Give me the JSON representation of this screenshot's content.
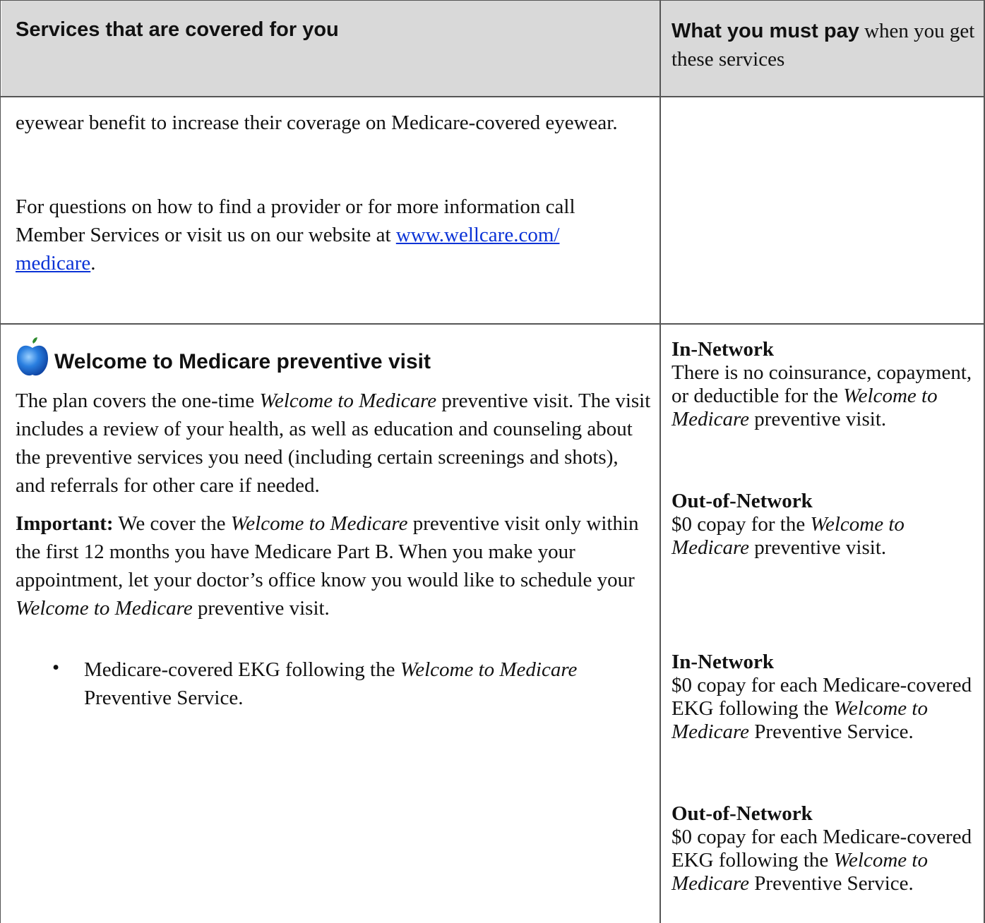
{
  "header": {
    "left": "Services that are covered for you",
    "right_bold": "What you must pay",
    "right_rest": " when you get these services"
  },
  "row1": {
    "p1": "eyewear benefit to increase their coverage on Medicare-covered eyewear.",
    "p2_before": "For questions on how to find a provider or for more information call Member Services or visit us on our website at ",
    "p2_link": "www.wellcare.com/ medicare",
    "p2_after": "."
  },
  "row2": {
    "icon": "apple-icon",
    "title": "Welcome to Medicare preventive visit",
    "p1_a": "The plan covers the one-time ",
    "p1_i": "Welcome to Medicare",
    "p1_b": " preventive visit. The visit includes a review of your health, as well as education and counseling about the preventive services you need (including certain screenings and shots), and referrals for other care if needed.",
    "p2_bold": "Important:",
    "p2_a": " We cover the ",
    "p2_i1": "Welcome to Medicare",
    "p2_b": " preventive visit only within the first 12 months you have Medicare Part B. When you make your appointment, let your doctor’s office know you would like to schedule your ",
    "p2_i2": "Welcome to Medicare",
    "p2_c": " preventive visit.",
    "bullet": "•",
    "bullet_a": "Medicare-covered EKG following the ",
    "bullet_i": "Welcome to Medicare",
    "bullet_b": " Preventive Service.",
    "right1": {
      "in_heading": "In-Network",
      "in_a": "There is no coinsurance, copayment, or deductible for the ",
      "in_i": "Welcome to Medicare",
      "in_b": " preventive visit.",
      "out_heading": "Out-of-Network",
      "out_a": "$0 copay for the ",
      "out_i": "Welcome to Medicare",
      "out_b": " preventive visit."
    },
    "right2": {
      "in_heading": "In-Network",
      "in_a": "$0 copay for each Medicare-covered EKG following the ",
      "in_i": "Welcome to Medicare",
      "in_b": " Preventive Service.",
      "out_heading": "Out-of-Network",
      "out_a": "$0 copay for each Medicare-covered EKG following the ",
      "out_i": "Welcome to Medicare",
      "out_b": " Preventive Service."
    }
  }
}
